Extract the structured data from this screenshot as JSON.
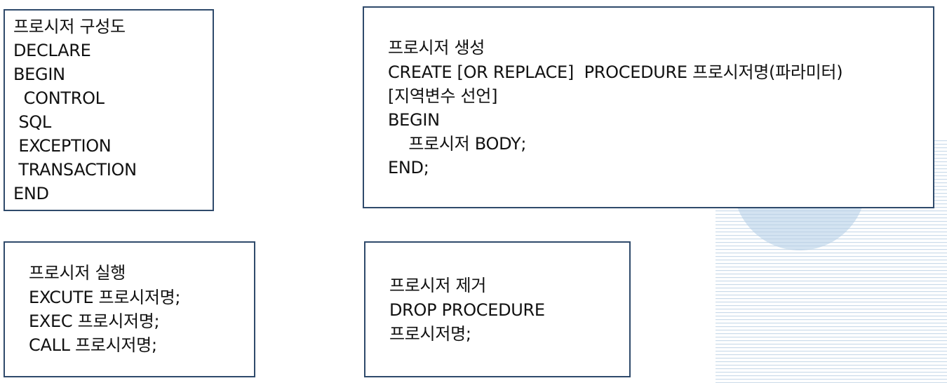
{
  "accent_color": "#2f4a6b",
  "structure": {
    "lines": [
      "프로시저 구성도",
      "DECLARE",
      "BEGIN",
      "  CONTROL",
      " SQL",
      " EXCEPTION",
      " TRANSACTION",
      "END"
    ]
  },
  "create": {
    "lines": [
      "프로시저 생성",
      "CREATE [OR REPLACE]  PROCEDURE 프로시저명(파라미터)",
      "[지역변수 선언]",
      "BEGIN",
      "    프로시저 BODY;",
      "END;"
    ]
  },
  "execute": {
    "lines": [
      "프로시저 실행",
      "EXCUTE 프로시저명;",
      "EXEC 프로시저명;",
      "CALL 프로시저명;"
    ]
  },
  "drop": {
    "lines": [
      "프로시저 제거",
      "DROP PROCEDURE",
      "프로시저명;"
    ]
  }
}
